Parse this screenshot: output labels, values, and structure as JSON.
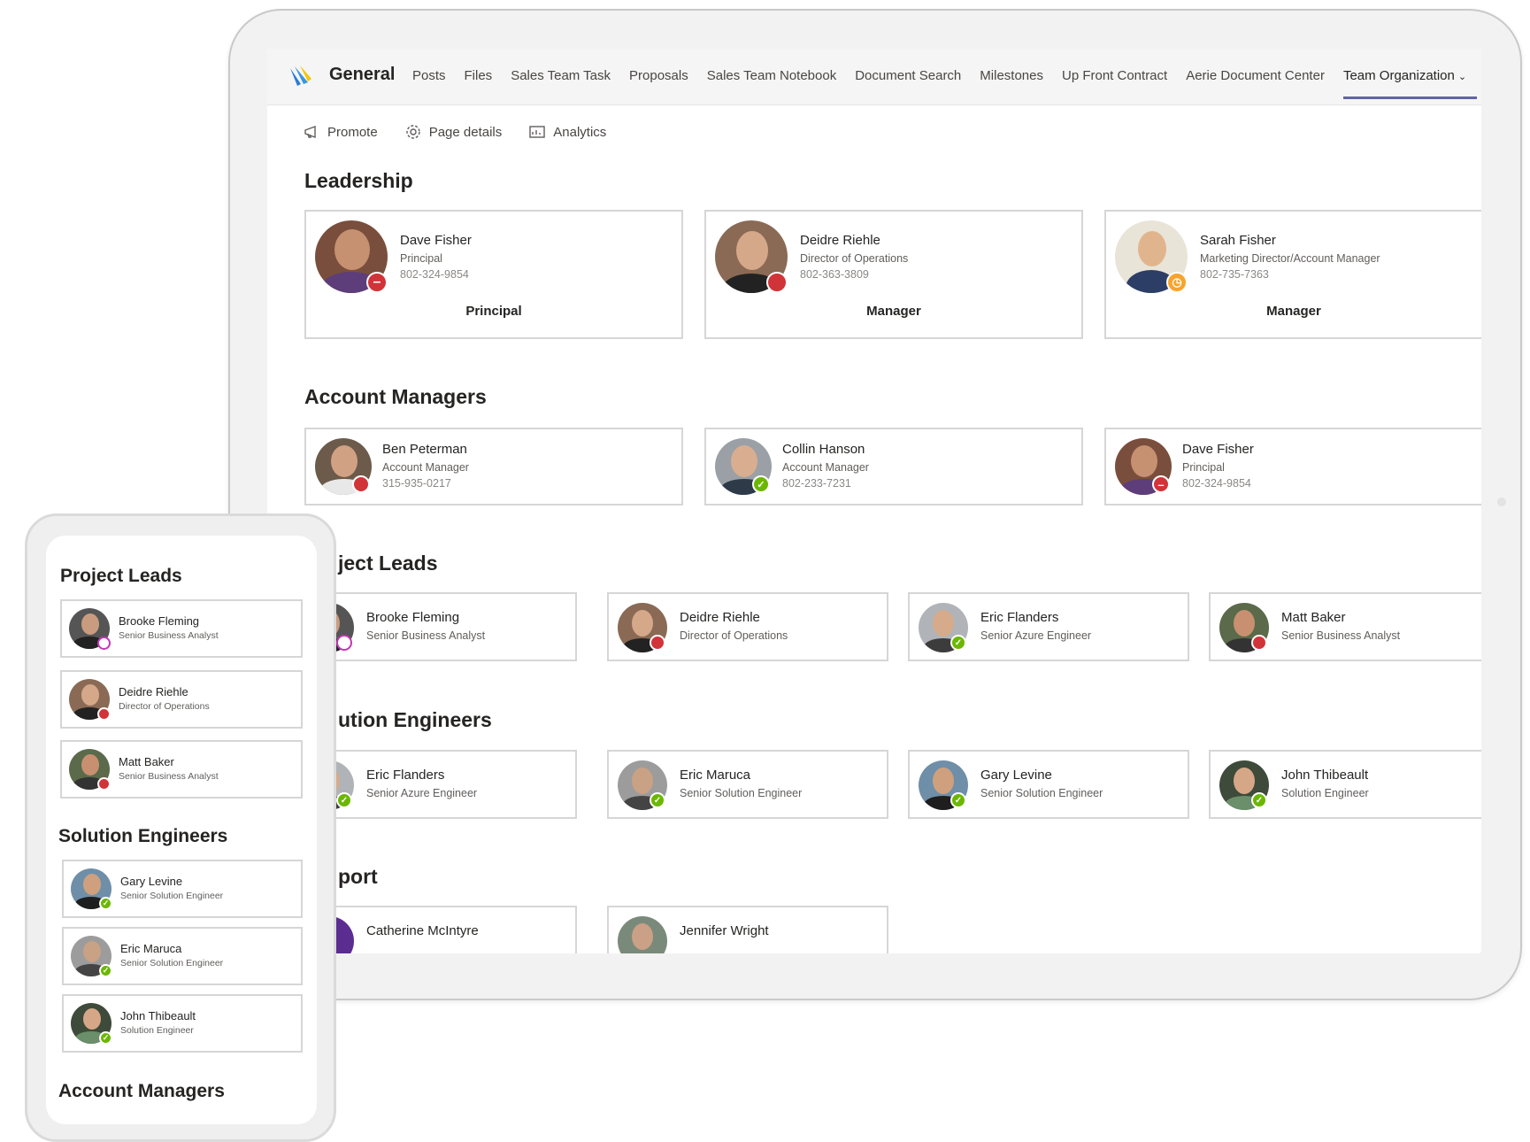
{
  "teams": {
    "channel": "General",
    "tabs": [
      "Posts",
      "Files",
      "Sales Team Task",
      "Proposals",
      "Sales Team Notebook",
      "Document Search",
      "Milestones",
      "Up Front Contract",
      "Aerie Document Center",
      "Team Organization"
    ],
    "active_tab": "Team Organization",
    "commands": [
      "Promote",
      "Page details",
      "Analytics"
    ],
    "colors": {
      "accent": "#6264a7",
      "dnd": "#d13438",
      "available": "#6bb700",
      "away": "#f8a42c"
    }
  },
  "desktop": {
    "leadership": {
      "title": "Leadership",
      "cards": [
        {
          "name": "Dave Fisher",
          "role": "Principal",
          "phone": "802-324-9854",
          "label": "Principal",
          "presence": "dnd"
        },
        {
          "name": "Deidre Riehle",
          "role": "Director of Operations",
          "phone": "802-363-3809",
          "label": "Manager",
          "presence": "busy"
        },
        {
          "name": "Sarah Fisher",
          "role": "Marketing Director/Account Manager",
          "phone": "802-735-7363",
          "label": "Manager",
          "presence": "away"
        }
      ]
    },
    "account_managers": {
      "title": "Account Managers",
      "cards": [
        {
          "name": "Ben Peterman",
          "role": "Account Manager",
          "phone": "315-935-0217",
          "presence": "busy"
        },
        {
          "name": "Collin Hanson",
          "role": "Account Manager",
          "phone": "802-233-7231",
          "presence": "available"
        },
        {
          "name": "Dave Fisher",
          "role": "Principal",
          "phone": "802-324-9854",
          "presence": "dnd"
        }
      ]
    },
    "project_leads": {
      "title": "ject Leads",
      "cards": [
        {
          "name": "Brooke Fleming",
          "role": "Senior Business Analyst",
          "presence": "oof"
        },
        {
          "name": "Deidre Riehle",
          "role": "Director of Operations",
          "presence": "busy"
        },
        {
          "name": "Eric Flanders",
          "role": "Senior Azure Engineer",
          "presence": "available"
        },
        {
          "name": "Matt Baker",
          "role": "Senior Business Analyst",
          "presence": "busy"
        }
      ]
    },
    "solution_engineers": {
      "title": "ution Engineers",
      "cards": [
        {
          "name": "Eric Flanders",
          "role": "Senior Azure Engineer",
          "presence": "available"
        },
        {
          "name": "Eric Maruca",
          "role": "Senior Solution Engineer",
          "presence": "available"
        },
        {
          "name": "Gary Levine",
          "role": "Senior Solution Engineer",
          "presence": "available"
        },
        {
          "name": "John Thibeault",
          "role": "Solution Engineer",
          "presence": "available"
        }
      ]
    },
    "support": {
      "title": "port",
      "cards": [
        {
          "name": "Catherine McIntyre"
        },
        {
          "name": "Jennifer Wright"
        }
      ]
    }
  },
  "mobile": {
    "project_leads": {
      "title": "Project Leads",
      "cards": [
        {
          "name": "Brooke Fleming",
          "role": "Senior Business Analyst"
        },
        {
          "name": "Deidre Riehle",
          "role": "Director of Operations"
        },
        {
          "name": "Matt Baker",
          "role": "Senior Business Analyst"
        }
      ]
    },
    "solution_engineers": {
      "title": "Solution Engineers",
      "cards": [
        {
          "name": "Gary Levine",
          "role": "Senior Solution Engineer"
        },
        {
          "name": "Eric Maruca",
          "role": "Senior Solution Engineer"
        },
        {
          "name": "John Thibeault",
          "role": "Solution Engineer"
        }
      ]
    },
    "account_managers": {
      "title": "Account Managers"
    }
  }
}
